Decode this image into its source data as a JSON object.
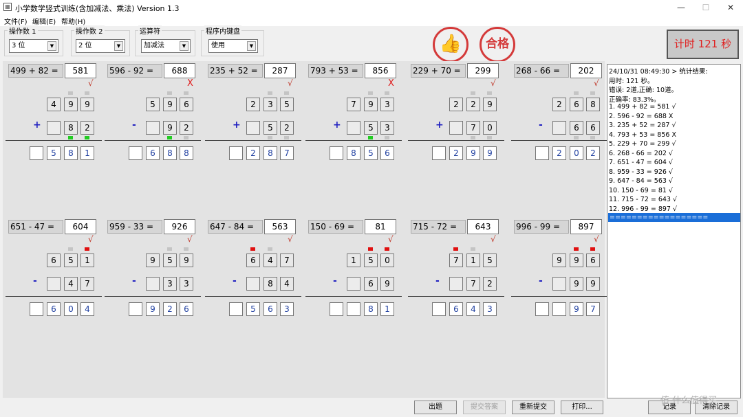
{
  "window": {
    "title": "小学数学竖式训练(含加减法、乘法) Version 1.3",
    "minimize": "—",
    "maximize": "☐",
    "close": "✕"
  },
  "menu": [
    "文件(F)",
    "编辑(E)",
    "帮助(H)"
  ],
  "toolbar": {
    "groups": [
      {
        "label": "操作数 1",
        "value": "3 位"
      },
      {
        "label": "操作数 2",
        "value": "2 位"
      },
      {
        "label": "运算符",
        "value": "加减法"
      },
      {
        "label": "程序内键盘",
        "value": "使用"
      }
    ],
    "stamps": {
      "thumb": "👍",
      "pass": "合格"
    },
    "timer": "计时  121 秒"
  },
  "problems": [
    {
      "eq": "499 + 82 =",
      "ans": "581",
      "mark": "√",
      "ok": true,
      "op": "+",
      "top": [
        "4",
        "9",
        "9"
      ],
      "bottom": [
        "",
        "8",
        "2"
      ],
      "result": [
        "",
        "5",
        "8",
        "1"
      ],
      "ind_top": [
        "",
        "g",
        "g"
      ],
      "ind_bottom": [
        "",
        "green",
        "green"
      ]
    },
    {
      "eq": "596 - 92 =",
      "ans": "688",
      "mark": "X",
      "ok": false,
      "op": "-",
      "top": [
        "5",
        "9",
        "6"
      ],
      "bottom": [
        "",
        "9",
        "2"
      ],
      "result": [
        "",
        "6",
        "8",
        "8"
      ],
      "ind_top": [
        "",
        "g",
        "g"
      ],
      "ind_bottom": [
        "",
        "green",
        "g"
      ]
    },
    {
      "eq": "235 + 52 =",
      "ans": "287",
      "mark": "√",
      "ok": true,
      "op": "+",
      "top": [
        "2",
        "3",
        "5"
      ],
      "bottom": [
        "",
        "5",
        "2"
      ],
      "result": [
        "",
        "2",
        "8",
        "7"
      ],
      "ind_top": [
        "",
        "g",
        "g"
      ],
      "ind_bottom": [
        "",
        "g",
        "g"
      ]
    },
    {
      "eq": "793 + 53 =",
      "ans": "856",
      "mark": "X",
      "ok": false,
      "op": "+",
      "top": [
        "7",
        "9",
        "3"
      ],
      "bottom": [
        "",
        "5",
        "3"
      ],
      "result": [
        "",
        "8",
        "5",
        "6"
      ],
      "ind_top": [
        "",
        "g",
        "g"
      ],
      "ind_bottom": [
        "",
        "green",
        "g"
      ]
    },
    {
      "eq": "229 + 70 =",
      "ans": "299",
      "mark": "√",
      "ok": true,
      "op": "+",
      "top": [
        "2",
        "2",
        "9"
      ],
      "bottom": [
        "",
        "7",
        "0"
      ],
      "result": [
        "",
        "2",
        "9",
        "9"
      ],
      "ind_top": [
        "",
        "g",
        "g"
      ],
      "ind_bottom": [
        "",
        "g",
        "g"
      ]
    },
    {
      "eq": "268 - 66 =",
      "ans": "202",
      "mark": "√",
      "ok": true,
      "op": "-",
      "top": [
        "2",
        "6",
        "8"
      ],
      "bottom": [
        "",
        "6",
        "6"
      ],
      "result": [
        "",
        "2",
        "0",
        "2"
      ],
      "ind_top": [
        "",
        "g",
        "g"
      ],
      "ind_bottom": [
        "",
        "g",
        "g"
      ]
    },
    {
      "eq": "651 - 47 =",
      "ans": "604",
      "mark": "√",
      "ok": true,
      "op": "-",
      "top": [
        "6",
        "5",
        "1"
      ],
      "bottom": [
        "",
        "4",
        "7"
      ],
      "result": [
        "",
        "6",
        "0",
        "4"
      ],
      "ind_top": [
        "",
        "g",
        "red"
      ],
      "ind_bottom": [
        "",
        "",
        ""
      ]
    },
    {
      "eq": "959 - 33 =",
      "ans": "926",
      "mark": "√",
      "ok": true,
      "op": "-",
      "top": [
        "9",
        "5",
        "9"
      ],
      "bottom": [
        "",
        "3",
        "3"
      ],
      "result": [
        "",
        "9",
        "2",
        "6"
      ],
      "ind_top": [
        "",
        "g",
        "g"
      ],
      "ind_bottom": [
        "",
        "",
        ""
      ]
    },
    {
      "eq": "647 - 84 =",
      "ans": "563",
      "mark": "√",
      "ok": true,
      "op": "-",
      "top": [
        "6",
        "4",
        "7"
      ],
      "bottom": [
        "",
        "8",
        "4"
      ],
      "result": [
        "",
        "5",
        "6",
        "3"
      ],
      "ind_top": [
        "red",
        "g",
        ""
      ],
      "ind_bottom": [
        "",
        "",
        ""
      ]
    },
    {
      "eq": "150 - 69 =",
      "ans": "81",
      "mark": "√",
      "ok": true,
      "op": "-",
      "top": [
        "1",
        "5",
        "0"
      ],
      "bottom": [
        "",
        "6",
        "9"
      ],
      "result": [
        "",
        "",
        "8",
        "1"
      ],
      "ind_top": [
        "",
        "red",
        "red"
      ],
      "ind_bottom": [
        "",
        "",
        ""
      ]
    },
    {
      "eq": "715 - 72 =",
      "ans": "643",
      "mark": "√",
      "ok": true,
      "op": "-",
      "top": [
        "7",
        "1",
        "5"
      ],
      "bottom": [
        "",
        "7",
        "2"
      ],
      "result": [
        "",
        "6",
        "4",
        "3"
      ],
      "ind_top": [
        "red",
        "g",
        ""
      ],
      "ind_bottom": [
        "",
        "",
        ""
      ]
    },
    {
      "eq": "996 - 99 =",
      "ans": "897",
      "mark": "√",
      "ok": true,
      "op": "-",
      "top": [
        "9",
        "9",
        "6"
      ],
      "bottom": [
        "",
        "9",
        "9"
      ],
      "result": [
        "",
        "",
        "9",
        "7"
      ],
      "ind_top": [
        "",
        "red",
        "red"
      ],
      "ind_bottom": [
        "",
        "",
        ""
      ]
    }
  ],
  "log": {
    "lines": [
      "24/10/31 08:49:30 > 统计结果:",
      "用时: 121 秒。",
      "错误: 2道,正确: 10道。",
      "正确率: 83.3%。",
      "1. 499 + 82 = 581 √",
      "2. 596 - 92 = 688 X",
      "3. 235 + 52 = 287 √",
      "4. 793 + 53 = 856 X",
      "5. 229 + 70 = 299 √",
      "6. 268 - 66 = 202 √",
      "7. 651 - 47 = 604 √",
      "8. 959 - 33 = 926 √",
      "9. 647 - 84 = 563 √",
      "10. 150 - 69 = 81 √",
      "11. 715 - 72 = 643 √",
      "12. 996 - 99 = 897 √"
    ],
    "selected": "=================="
  },
  "buttons": [
    "出题",
    "提交答案",
    "重新提交",
    "打印...",
    "记录",
    "清除记录"
  ],
  "watermark": "值 什么值得买"
}
